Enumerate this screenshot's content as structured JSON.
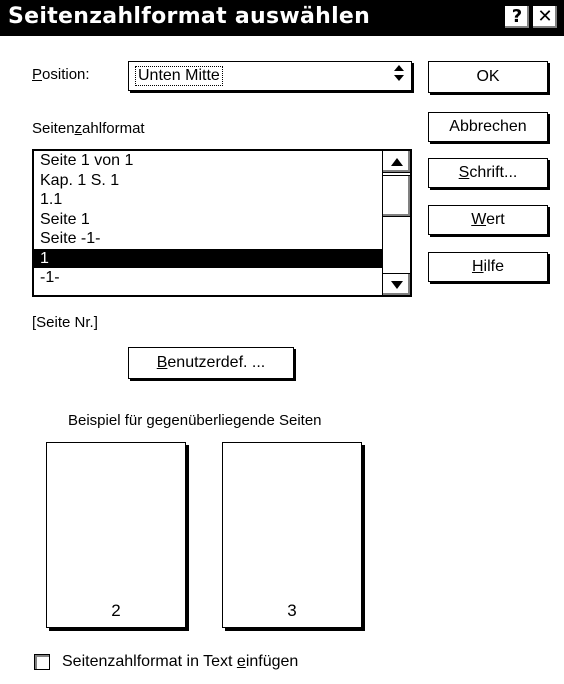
{
  "dialog": {
    "title": "Seitenzahlformat auswählen",
    "help_button": "?",
    "close_button": "✕"
  },
  "position": {
    "label_first": "P",
    "label_rest": "osition:",
    "value": "Unten Mitte",
    "arrow_icon": "up-down-arrows-icon"
  },
  "format_list": {
    "label_pre": "Seiten",
    "label_ul": "z",
    "label_post": "ahlformat",
    "items": [
      "Seite 1 von 1",
      "Kap. 1 S. 1",
      "1.1",
      "Seite 1",
      "Seite -1-",
      "1",
      "-1-"
    ],
    "selected_index": 5,
    "field_code": "[Seite Nr.]"
  },
  "buttons": {
    "ok": "OK",
    "cancel": "Abbrechen",
    "font_first": "S",
    "font_rest": "chrift...",
    "value_first": "W",
    "value_rest": "ert",
    "help_first": "H",
    "help_rest": "ilfe",
    "custom_first": "B",
    "custom_rest": "enutzerdef. ..."
  },
  "preview": {
    "caption": "Beispiel für gegenüberliegende Seiten",
    "left_page_number": "2",
    "right_page_number": "3"
  },
  "insert_option": {
    "label_pre": "Seitenzahlformat in Text ",
    "label_ul": "e",
    "label_post": "infügen",
    "checked": false
  },
  "colors": {
    "titlebar": "#000000",
    "background": "#ffffff",
    "selection": "#000000"
  }
}
